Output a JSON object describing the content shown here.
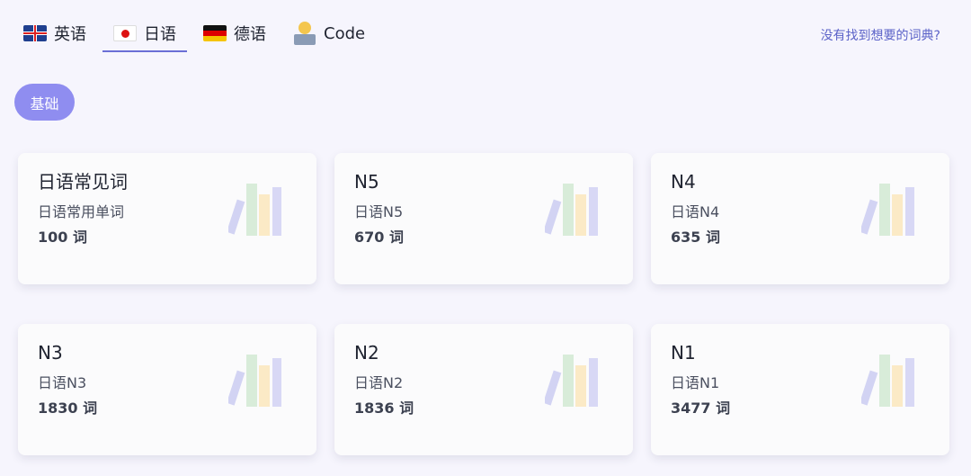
{
  "tabs": [
    {
      "label": "英语",
      "icon": "uk-flag-icon"
    },
    {
      "label": "日语",
      "icon": "japan-flag-icon",
      "active": true
    },
    {
      "label": "德语",
      "icon": "germany-flag-icon"
    },
    {
      "label": "Code",
      "icon": "coder-emoji-icon"
    }
  ],
  "missing_dict_link": "没有找到想要的词典?",
  "category_pill": "基础",
  "cards": [
    {
      "title": "日语常见词",
      "subtitle": "日语常用单词",
      "count": "100 词"
    },
    {
      "title": "N5",
      "subtitle": "日语N5",
      "count": "670 词"
    },
    {
      "title": "N4",
      "subtitle": "日语N4",
      "count": "635 词"
    },
    {
      "title": "N3",
      "subtitle": "日语N3",
      "count": "1830 词"
    },
    {
      "title": "N2",
      "subtitle": "日语N2",
      "count": "1836 词"
    },
    {
      "title": "N1",
      "subtitle": "日语N1",
      "count": "3477 词"
    }
  ],
  "colors": {
    "accent": "#8f8df0",
    "link": "#5b62c8",
    "background": "#f6f5fd"
  }
}
